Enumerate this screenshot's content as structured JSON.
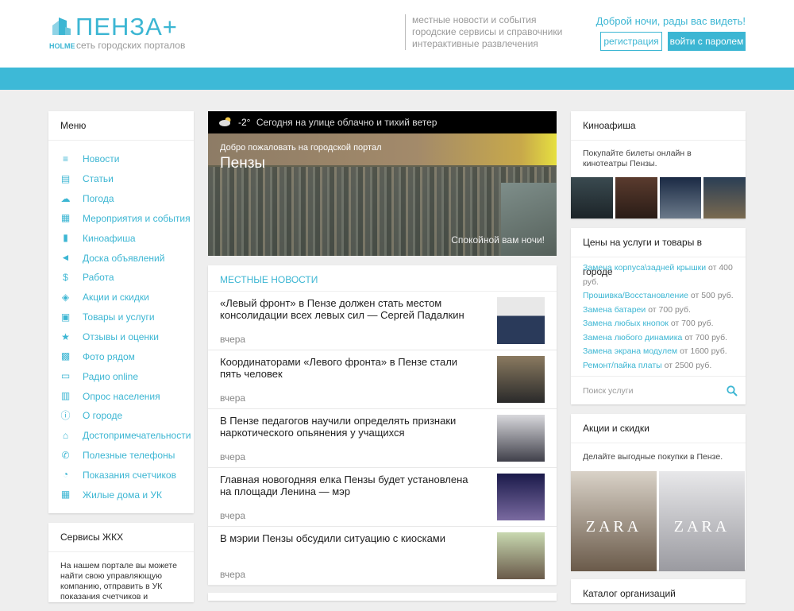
{
  "header": {
    "logo": "ПЕНЗА+",
    "logo_tag": "HOLME",
    "logo_sub": "сеть городских порталов",
    "tagline": [
      "местные новости и события",
      "городские сервисы и справочники",
      "интерактивные развлечения"
    ],
    "greeting": "Доброй ночи, рады вас видеть!",
    "register": "регистрация",
    "login": "войти с паролем"
  },
  "menu": {
    "title": "Меню",
    "items": [
      {
        "label": "Новости",
        "icon": "list-icon"
      },
      {
        "label": "Статьи",
        "icon": "article-icon"
      },
      {
        "label": "Погода",
        "icon": "weather-icon"
      },
      {
        "label": "Мероприятия и события",
        "icon": "calendar-icon"
      },
      {
        "label": "Киноафиша",
        "icon": "film-icon"
      },
      {
        "label": "Доска объявлений",
        "icon": "megaphone-icon"
      },
      {
        "label": "Работа",
        "icon": "dollar-icon"
      },
      {
        "label": "Акции и скидки",
        "icon": "tag-icon"
      },
      {
        "label": "Товары и услуги",
        "icon": "bag-icon"
      },
      {
        "label": "Отзывы и оценки",
        "icon": "star-icon"
      },
      {
        "label": "Фото рядом",
        "icon": "photo-icon"
      },
      {
        "label": "Радио online",
        "icon": "radio-icon"
      },
      {
        "label": "Опрос населения",
        "icon": "chart-icon"
      },
      {
        "label": "О городе",
        "icon": "info-icon"
      },
      {
        "label": "Достопримечательности",
        "icon": "landmark-icon"
      },
      {
        "label": "Полезные телефоны",
        "icon": "phone-icon"
      },
      {
        "label": "Показания счетчиков",
        "icon": "meter-icon"
      },
      {
        "label": "Жилые дома и УК",
        "icon": "building-icon"
      }
    ]
  },
  "zhkh": {
    "title": "Сервисы ЖКХ",
    "text": "На нашем портале вы можете найти свою управляющую компанию, отправить в УК показания счетчиков и"
  },
  "hero": {
    "temp": "-2°",
    "weather": "Сегодня на улице облачно и тихий ветер",
    "welcome": "Добро пожаловать на городской портал",
    "city": "Пензы",
    "night": "Спокойной вам ночи!"
  },
  "news": {
    "title": "МЕСТНЫЕ НОВОСТИ",
    "items": [
      {
        "title": "«Левый фронт» в Пензе должен стать местом консолидации всех левых сил — Сергей Падалкин",
        "date": "вчера"
      },
      {
        "title": "Координаторами «Левого фронта» в Пензе стали пять человек",
        "date": "вчера"
      },
      {
        "title": "В Пензе педагогов научили определять признаки наркотического опьянения у учащихся",
        "date": "вчера"
      },
      {
        "title": "Главная новогодняя елка Пензы будет установлена на площади Ленина — мэр",
        "date": "вчера"
      },
      {
        "title": "В мэрии Пензы обсудили ситуацию с киосками",
        "date": "вчера"
      }
    ]
  },
  "kino": {
    "title": "Киноафиша",
    "text": "Покупайте билеты онлайн в кинотеатры Пензы."
  },
  "prices": {
    "title": "Цены на услуги и товары в городе",
    "items": [
      {
        "name": "Замена корпуса\\задней крышки",
        "price": "от 400 руб."
      },
      {
        "name": "Прошивка/Восстановление",
        "price": "от 500 руб."
      },
      {
        "name": "Замена батареи",
        "price": "от 700 руб."
      },
      {
        "name": "Замена любых кнопок",
        "price": "от 700 руб."
      },
      {
        "name": "Замена любого динамика",
        "price": "от 700 руб."
      },
      {
        "name": "Замена экрана модулем",
        "price": "от 1600 руб."
      },
      {
        "name": "Ремонт/пайка платы",
        "price": "от 2500 руб."
      }
    ],
    "search_placeholder": "Поиск услуги"
  },
  "sales": {
    "title": "Акции и скидки",
    "text": "Делайте выгодные покупки в Пензе.",
    "brand": "ZARA"
  },
  "catalog": {
    "title": "Каталог организаций"
  },
  "colors": {
    "accent": "#3cb6d3"
  }
}
